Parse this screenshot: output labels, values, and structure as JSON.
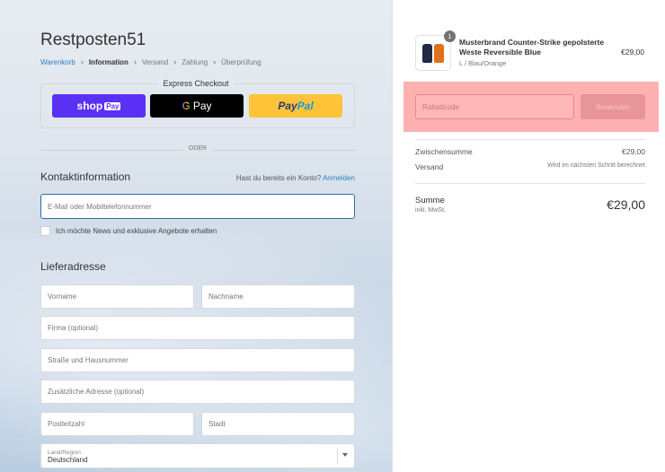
{
  "shop": {
    "name": "Restposten51"
  },
  "breadcrumb": {
    "items": [
      "Warenkorb",
      "Information",
      "Versand",
      "Zahlung",
      "Überprüfung"
    ],
    "active": "Information"
  },
  "express": {
    "title": "Express Checkout",
    "shoppay_label": "shop",
    "shoppay_badge": "Pay",
    "gpay_g": "G",
    "gpay_label": "Pay",
    "paypal_part1": "Pay",
    "paypal_part2": "Pal"
  },
  "divider_label": "ODER",
  "contact": {
    "title": "Kontaktinformation",
    "login_question": "Hast du bereits ein Konto?",
    "login_link": "Anmelden",
    "email_placeholder": "E-Mail oder Mobiltelefonnummer",
    "newsletter_label": "Ich möchte News und exklusive Angebote erhalten"
  },
  "shipping": {
    "title": "Lieferadresse",
    "first_name_placeholder": "Vorname",
    "last_name_placeholder": "Nachname",
    "company_placeholder": "Firma (optional)",
    "street_placeholder": "Straße und Hausnummer",
    "address2_placeholder": "Zusätzliche Adresse (optional)",
    "zip_placeholder": "Postleitzahl",
    "city_placeholder": "Stadt",
    "country_label": "Land/Region",
    "country_value": "Deutschland"
  },
  "cart": {
    "quantity": "1",
    "product_name": "Musterbrand Counter-Strike gepolsterte Weste Reversible Blue",
    "product_variant": "L / Blau/Orange",
    "product_price": "€29,00",
    "discount_placeholder": "Rabattcode",
    "apply_label": "Anwenden",
    "subtotal_label": "Zwischensumme",
    "subtotal_value": "€29,00",
    "shipping_label": "Versand",
    "shipping_value": "Wird im nächsten Schritt berechnet",
    "total_label": "Summe",
    "total_sub": "inkl. MwSt.",
    "total_value": "€29,00"
  },
  "colors": {
    "accent": "#2f80c0",
    "shoppay": "#5a31f4",
    "paypal": "#ffc439",
    "highlight": "#fdb1b1"
  }
}
